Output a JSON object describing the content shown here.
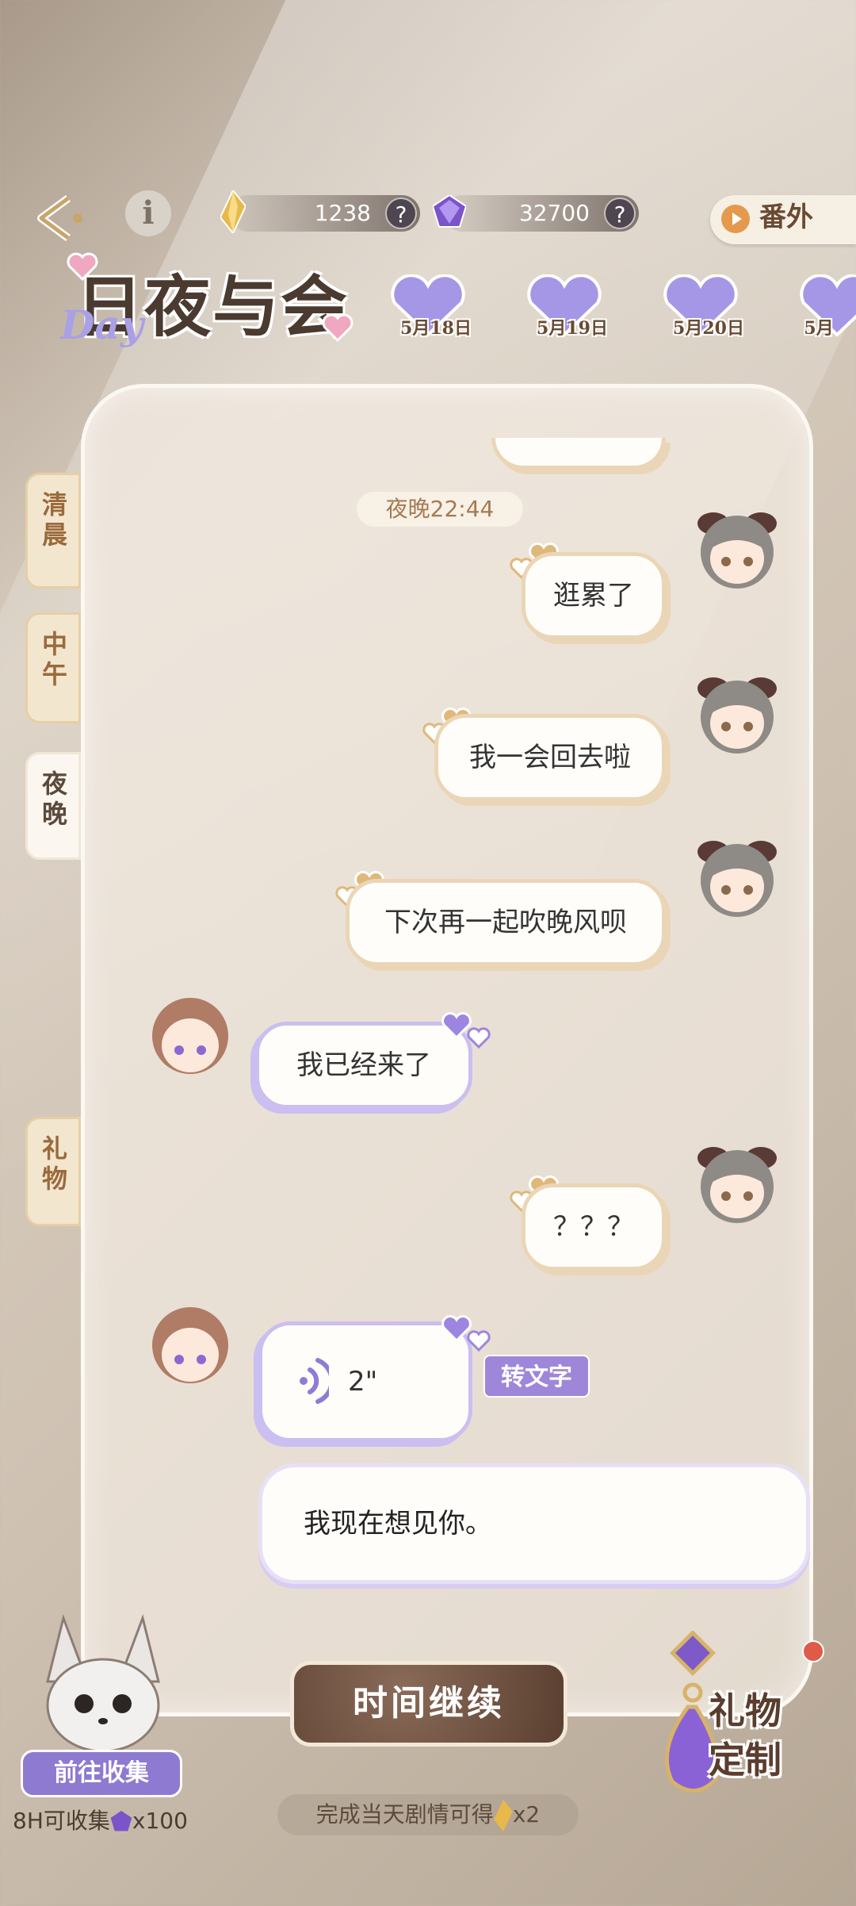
{
  "header": {
    "currency_gold": "1238",
    "currency_purple": "32700",
    "help_glyph": "?",
    "extra_label": "番外",
    "info_glyph": "i"
  },
  "logo": {
    "title": "日夜与会",
    "script": "Day"
  },
  "date_tabs": [
    "5月18日",
    "5月19日",
    "5月20日",
    "5月"
  ],
  "side_tabs": {
    "morning": "清晨",
    "noon": "中午",
    "night": "夜晚",
    "gift": "礼物"
  },
  "chat": {
    "time_chip": "夜晚22:44",
    "messages": [
      {
        "from": "me",
        "text": "逛累了"
      },
      {
        "from": "me",
        "text": "我一会回去啦"
      },
      {
        "from": "me",
        "text": "下次再一起吹晚风呗"
      },
      {
        "from": "her",
        "text": "我已经来了"
      },
      {
        "from": "me",
        "text": "？？？"
      }
    ],
    "voice_duration": "2\"",
    "to_text_label": "转文字",
    "transcript": "我现在想见你。"
  },
  "footer": {
    "continue_label": "时间继续",
    "reward_note": "完成当天剧情可得",
    "reward_count": "x2",
    "collect_label": "前往收集",
    "collect_note_prefix": "8H可收集",
    "collect_note_count": "x100",
    "gift_custom_label": "礼物\n定制"
  },
  "colors": {
    "me_border": "#ead6b6",
    "her_border": "#cbbef0",
    "accent_purple": "#9e87d8",
    "continue_brown": "#5a3f30"
  }
}
